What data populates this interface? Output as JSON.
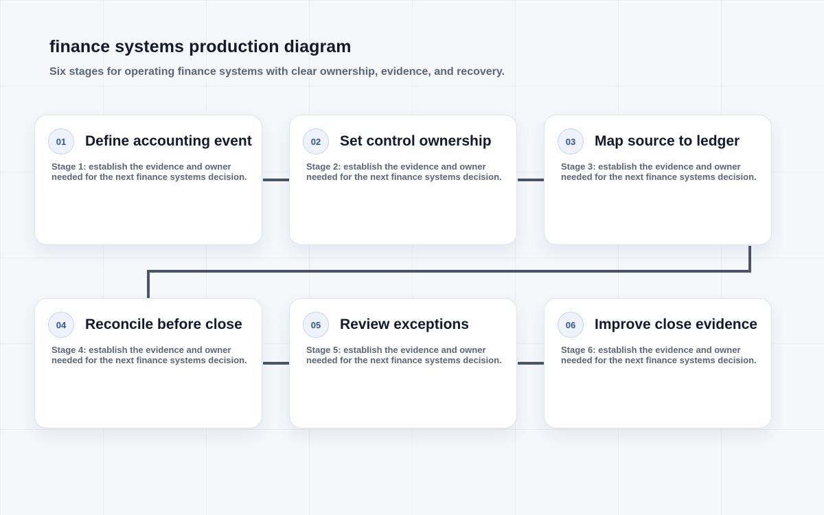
{
  "header": {
    "title": "finance systems production diagram",
    "subtitle": "Six stages for operating finance systems with clear ownership, evidence, and recovery."
  },
  "colors": {
    "connector": "#4a5568",
    "badge_text": "#2f5597",
    "title_text": "#131a2b",
    "body_text": "#5b6578"
  },
  "stages": [
    {
      "number": "01",
      "title": "Define accounting event",
      "description": "Stage 1: establish the evidence and owner needed for the next finance systems decision."
    },
    {
      "number": "02",
      "title": "Set control ownership",
      "description": "Stage 2: establish the evidence and owner needed for the next finance systems decision."
    },
    {
      "number": "03",
      "title": "Map source to ledger",
      "description": "Stage 3: establish the evidence and owner needed for the next finance systems decision."
    },
    {
      "number": "04",
      "title": "Reconcile before close",
      "description": "Stage 4: establish the evidence and owner needed for the next finance systems decision."
    },
    {
      "number": "05",
      "title": "Review exceptions",
      "description": "Stage 5: establish the evidence and owner needed for the next finance systems decision."
    },
    {
      "number": "06",
      "title": "Improve close evidence",
      "description": "Stage 6: establish the evidence and owner needed for the next finance systems decision."
    }
  ]
}
